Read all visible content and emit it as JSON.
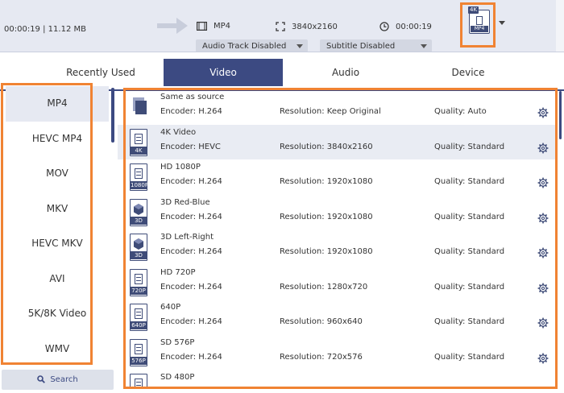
{
  "top": {
    "source_duration": "00:00:19",
    "source_size": "11.12 MB",
    "output_format": "MP4",
    "output_resolution": "3840x2160",
    "output_duration": "00:00:19",
    "audio_dropdown": "Audio Track Disabled",
    "subtitle_dropdown": "Subtitle Disabled",
    "format_button_badge": "4K",
    "format_button_label": "MP4"
  },
  "tabs": [
    "Recently Used",
    "Video",
    "Audio",
    "Device"
  ],
  "active_tab": "Video",
  "formats": [
    "MP4",
    "HEVC MP4",
    "MOV",
    "MKV",
    "HEVC MKV",
    "AVI",
    "5K/8K Video",
    "WMV"
  ],
  "active_format": "MP4",
  "search_label": "Search",
  "presets": [
    {
      "name": "Same as source",
      "encoder": "Encoder: H.264",
      "resolution": "Resolution: Keep Original",
      "quality": "Quality: Auto",
      "icon": "same-as-source-icon",
      "tag": ""
    },
    {
      "name": "4K Video",
      "encoder": "Encoder: HEVC",
      "resolution": "Resolution: 3840x2160",
      "quality": "Quality: Standard",
      "icon": "film-icon",
      "tag": "4K"
    },
    {
      "name": "HD 1080P",
      "encoder": "Encoder: H.264",
      "resolution": "Resolution: 1920x1080",
      "quality": "Quality: Standard",
      "icon": "film-icon",
      "tag": "1080P"
    },
    {
      "name": "3D Red-Blue",
      "encoder": "Encoder: H.264",
      "resolution": "Resolution: 1920x1080",
      "quality": "Quality: Standard",
      "icon": "cube-icon",
      "tag": "3D"
    },
    {
      "name": "3D Left-Right",
      "encoder": "Encoder: H.264",
      "resolution": "Resolution: 1920x1080",
      "quality": "Quality: Standard",
      "icon": "cube-icon",
      "tag": "3D"
    },
    {
      "name": "HD 720P",
      "encoder": "Encoder: H.264",
      "resolution": "Resolution: 1280x720",
      "quality": "Quality: Standard",
      "icon": "film-icon",
      "tag": "720P"
    },
    {
      "name": "640P",
      "encoder": "Encoder: H.264",
      "resolution": "Resolution: 960x640",
      "quality": "Quality: Standard",
      "icon": "film-icon",
      "tag": "640P"
    },
    {
      "name": "SD 576P",
      "encoder": "Encoder: H.264",
      "resolution": "Resolution: 720x576",
      "quality": "Quality: Standard",
      "icon": "film-icon",
      "tag": "576P"
    },
    {
      "name": "SD 480P",
      "encoder": "",
      "resolution": "",
      "quality": "",
      "icon": "film-icon",
      "tag": ""
    }
  ],
  "colors": {
    "accent": "#3c4a82",
    "highlight": "#f08333",
    "row_alt": "#e9ecf3"
  }
}
